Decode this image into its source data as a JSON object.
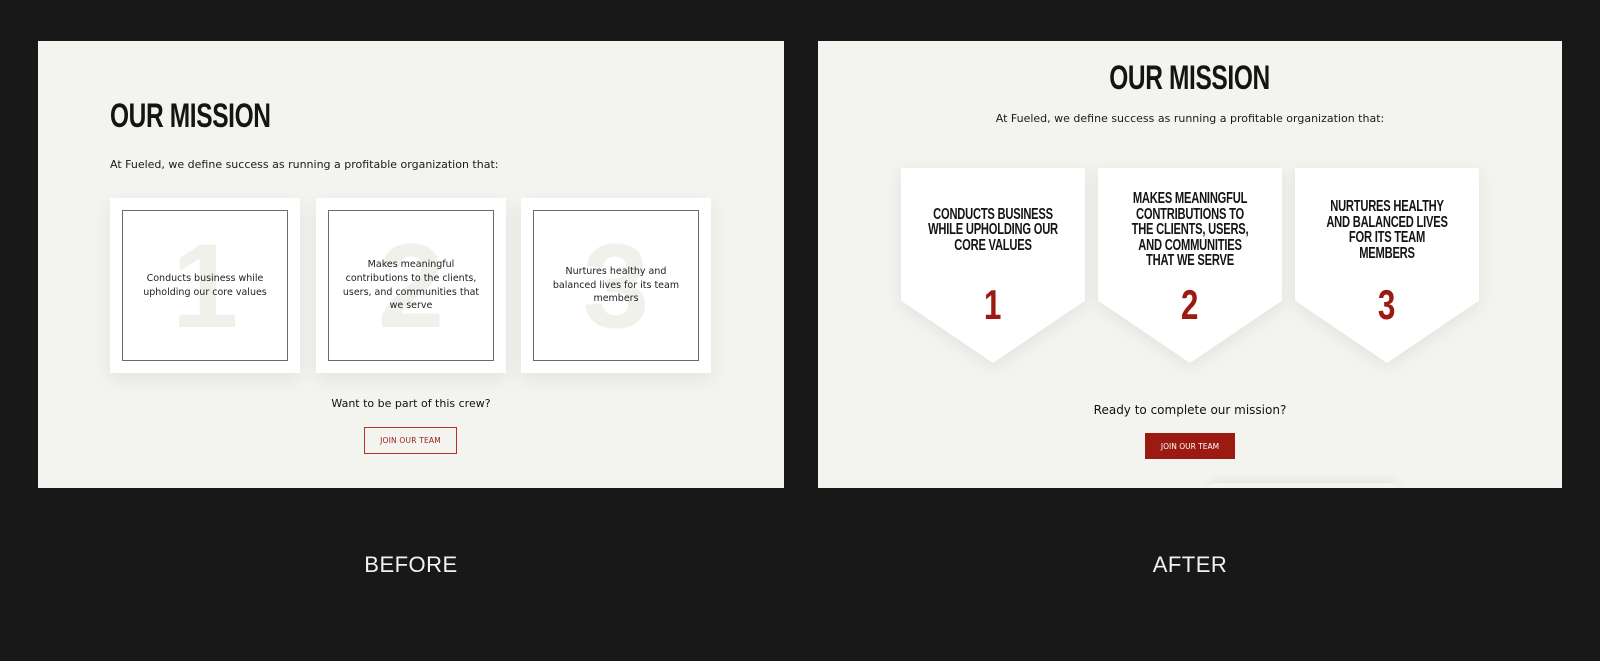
{
  "before": {
    "title": "OUR MISSION",
    "intro": "At Fueled, we define success as running a profitable organization that:",
    "cards": [
      {
        "number": "1",
        "text": "Conducts business while upholding our core values"
      },
      {
        "number": "2",
        "text": "Makes meaningful contributions to the clients, users, and communities that we serve"
      },
      {
        "number": "3",
        "text": "Nurtures healthy and balanced lives for its team members"
      }
    ],
    "question": "Want to be part of this crew?",
    "button_label": "JOIN OUR TEAM",
    "caption": "BEFORE"
  },
  "after": {
    "title": "OUR MISSION",
    "intro": "At Fueled, we define success as running a profitable organization that:",
    "cards": [
      {
        "number": "1",
        "text": "Conducts business while upholding our core values"
      },
      {
        "number": "2",
        "text": "Makes meaningful contributions to the clients, users, and communities that we serve"
      },
      {
        "number": "3",
        "text": "Nurtures healthy and balanced lives for its team members"
      }
    ],
    "question": "Ready to complete our mission?",
    "button_label": "JOIN OUR TEAM",
    "caption": "AFTER"
  },
  "colors": {
    "page_background": "#181818",
    "panel_background": "#f3f3ef",
    "accent": "#9b1b13"
  }
}
